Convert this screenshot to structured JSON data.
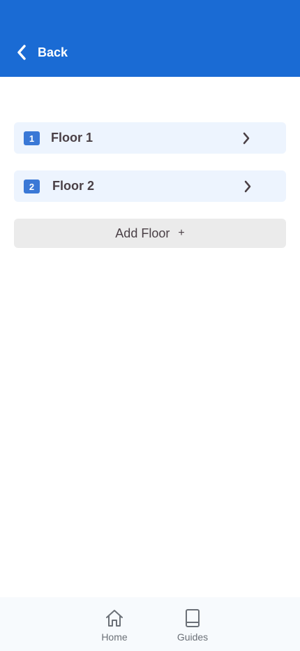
{
  "header": {
    "back_label": "Back",
    "background_color": "#1a6bd4"
  },
  "floors": [
    {
      "number": "1",
      "label": "Floor 1"
    },
    {
      "number": "2",
      "label": "Floor 2"
    }
  ],
  "add_floor": {
    "label": "Add Floor",
    "plus": "+"
  },
  "bottom_nav": {
    "items": [
      {
        "label": "Home",
        "icon": "home-icon"
      },
      {
        "label": "Guides",
        "icon": "book-icon"
      }
    ]
  },
  "colors": {
    "accent": "#1a6bd4",
    "badge": "#3a78d6",
    "row_bg": "#edf4fe",
    "button_bg": "#ebebeb",
    "text": "#4a4046"
  }
}
